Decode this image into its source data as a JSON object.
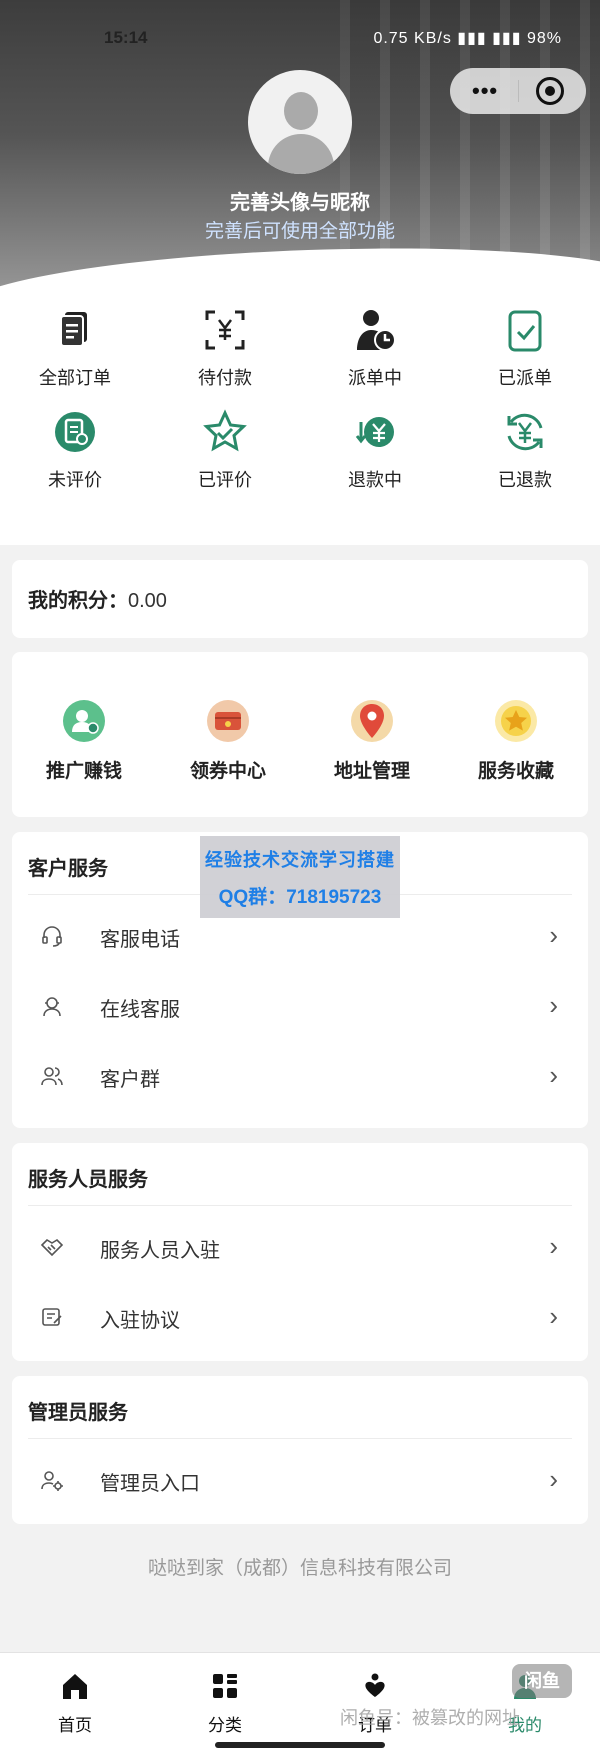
{
  "status": {
    "time": "15:14",
    "right": "0.75 KB/s  ▮▮▮  ▮▮▮  98%"
  },
  "capsule": {
    "more": "•••"
  },
  "profile": {
    "name": "完善头像与昵称",
    "hint": "完善后可使用全部功能"
  },
  "orders": [
    {
      "label": "全部订单",
      "icon": "document-icon"
    },
    {
      "label": "待付款",
      "icon": "scan-yen-icon"
    },
    {
      "label": "派单中",
      "icon": "person-clock-icon"
    },
    {
      "label": "已派单",
      "icon": "clipboard-check-icon"
    },
    {
      "label": "未评价",
      "icon": "note-icon"
    },
    {
      "label": "已评价",
      "icon": "star-check-icon"
    },
    {
      "label": "退款中",
      "icon": "yen-refund-icon"
    },
    {
      "label": "已退款",
      "icon": "yen-cycle-icon"
    }
  ],
  "points": {
    "label": "我的积分：",
    "value": "0.00"
  },
  "quick": [
    {
      "label": "推广赚钱",
      "icon": "promote-icon",
      "color": "#5cc08c"
    },
    {
      "label": "领券中心",
      "icon": "coupon-icon",
      "color": "#f1c9a9"
    },
    {
      "label": "地址管理",
      "icon": "location-icon",
      "color": "#e04a3a"
    },
    {
      "label": "服务收藏",
      "icon": "star-icon",
      "color": "#f6d24a"
    }
  ],
  "customer_service": {
    "title": "客户服务",
    "items": [
      {
        "label": "客服电话",
        "icon": "headset-icon"
      },
      {
        "label": "在线客服",
        "icon": "agent-icon"
      },
      {
        "label": "客户群",
        "icon": "group-icon"
      }
    ]
  },
  "staff_service": {
    "title": "服务人员服务",
    "items": [
      {
        "label": "服务人员入驻",
        "icon": "handshake-icon"
      },
      {
        "label": "入驻协议",
        "icon": "agreement-icon"
      }
    ]
  },
  "admin_service": {
    "title": "管理员服务",
    "items": [
      {
        "label": "管理员入口",
        "icon": "admin-icon"
      }
    ]
  },
  "watermark": {
    "line1": "经验技术交流学习搭建",
    "line2": "QQ群：718195723"
  },
  "company": "哒哒到家（成都）信息科技有限公司",
  "tabbar": [
    {
      "label": "首页",
      "icon": "home-icon"
    },
    {
      "label": "分类",
      "icon": "grid-icon"
    },
    {
      "label": "订单",
      "icon": "order-heart-icon"
    },
    {
      "label": "我的",
      "icon": "profile-icon"
    }
  ],
  "overlay": {
    "logo": "闲鱼",
    "text": "闲鱼号：被篡改的网址"
  },
  "colors": {
    "accent": "#2a8a6a",
    "text": "#222222",
    "muted": "#999999"
  }
}
